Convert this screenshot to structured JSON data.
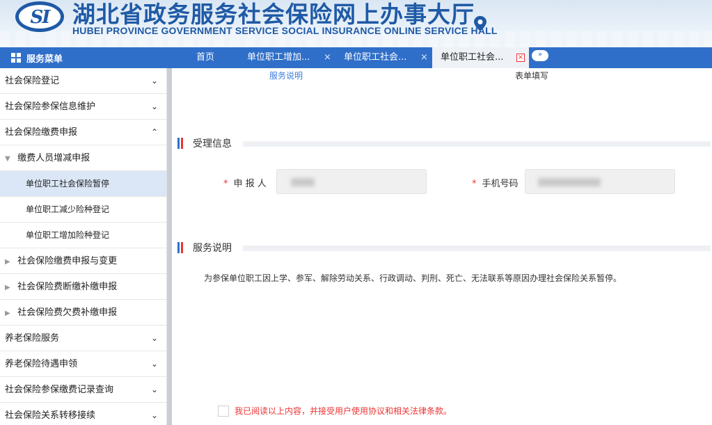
{
  "header": {
    "logo_text": "SI",
    "title_cn": "湖北省政务服务社会保险网上办事大厅",
    "title_en": "HUBEI PROVINCE GOVERNMENT SERVICE SOCIAL INSURANCE ONLINE SERVICE HALL"
  },
  "nav": {
    "menu_title": "服务菜单",
    "tabs": [
      {
        "label": "首页"
      },
      {
        "label": "单位职工增加...",
        "close": "×"
      },
      {
        "label": "单位职工社会...",
        "close": "×"
      },
      {
        "label": "单位职工社会...",
        "close": "×"
      }
    ],
    "more": "»"
  },
  "sidebar": {
    "items": [
      {
        "label": "社会保险登记",
        "chev": "⌄"
      },
      {
        "label": "社会保险参保信息维护",
        "chev": "⌄"
      },
      {
        "label": "社会保险缴费申报",
        "chev": "⌃"
      },
      {
        "label": "缴费人员增减申报",
        "tri": "▼"
      },
      {
        "label": "单位职工社会保险暂停"
      },
      {
        "label": "单位职工减少险种登记"
      },
      {
        "label": "单位职工增加险种登记"
      },
      {
        "label": "社会保险缴费申报与变更",
        "tri": "▶"
      },
      {
        "label": "社会保险费断缴补缴申报",
        "tri": "▶"
      },
      {
        "label": "社会保险费欠费补缴申报",
        "tri": "▶"
      },
      {
        "label": "养老保险服务",
        "chev": "⌄"
      },
      {
        "label": "养老保险待遇申领",
        "chev": "⌄"
      },
      {
        "label": "社会保险参保缴费记录查询",
        "chev": "⌄"
      },
      {
        "label": "社会保险关系转移接续",
        "chev": "⌄"
      }
    ]
  },
  "main": {
    "steps": {
      "service_desc": "服务说明",
      "form_fill": "表单填写"
    },
    "accept": {
      "title": "受理信息",
      "required_mark": "*",
      "applicant_label": "申 报 人",
      "phone_label": "手机号码"
    },
    "service": {
      "title": "服务说明",
      "text": "为参保单位职工因上学、参军、解除劳动关系、行政调动、判刑、死亡、无法联系等原因办理社会保险关系暂停。"
    },
    "agreement": "我已阅读以上内容，并接受用户使用协议和相关法律条款。"
  },
  "colors": {
    "brand_blue": "#1f5aa6",
    "nav_blue": "#2f6fc9",
    "required_red": "#e33333",
    "active_item_bg": "#dbe7f7"
  }
}
